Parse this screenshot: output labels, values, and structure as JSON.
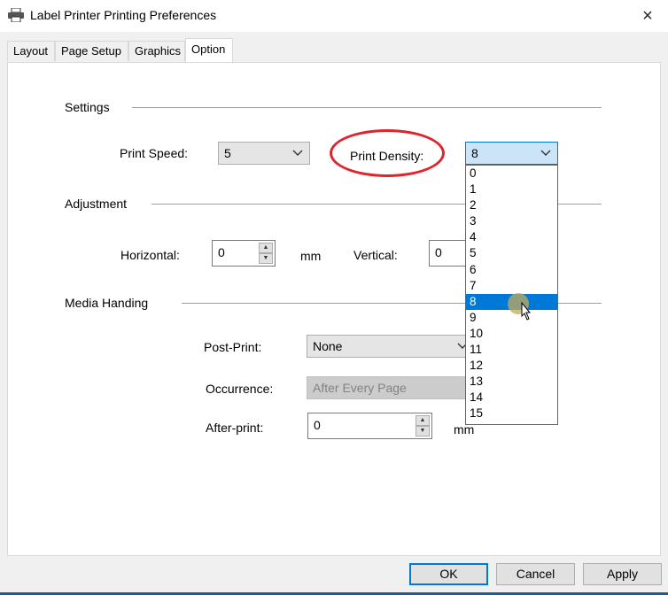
{
  "window": {
    "title": "Label Printer Printing Preferences",
    "close": "×"
  },
  "tabs": [
    {
      "label": "Layout"
    },
    {
      "label": "Page Setup"
    },
    {
      "label": "Graphics"
    },
    {
      "label": "Option"
    }
  ],
  "settings": {
    "heading": "Settings",
    "print_speed_label": "Print Speed:",
    "print_speed_value": "5",
    "print_density_label": "Print Density:",
    "print_density_value": "8",
    "density_options": [
      "0",
      "1",
      "2",
      "3",
      "4",
      "5",
      "6",
      "7",
      "8",
      "9",
      "10",
      "11",
      "12",
      "13",
      "14",
      "15"
    ],
    "density_selected_index": 8
  },
  "adjustment": {
    "heading": "Adjustment",
    "horizontal_label": "Horizontal:",
    "horizontal_value": "0",
    "unit": "mm",
    "vertical_label": "Vertical:",
    "vertical_value": "0"
  },
  "media": {
    "heading": "Media Handing",
    "post_print_label": "Post-Print:",
    "post_print_value": "None",
    "occurrence_label": "Occurrence:",
    "occurrence_value": "After Every Page",
    "after_print_label": "After-print:",
    "after_print_value": "0",
    "unit": "mm"
  },
  "buttons": {
    "ok": "OK",
    "cancel": "Cancel",
    "apply": "Apply"
  },
  "colors": {
    "accent": "#0078d7",
    "highlight": "#e0242b"
  }
}
